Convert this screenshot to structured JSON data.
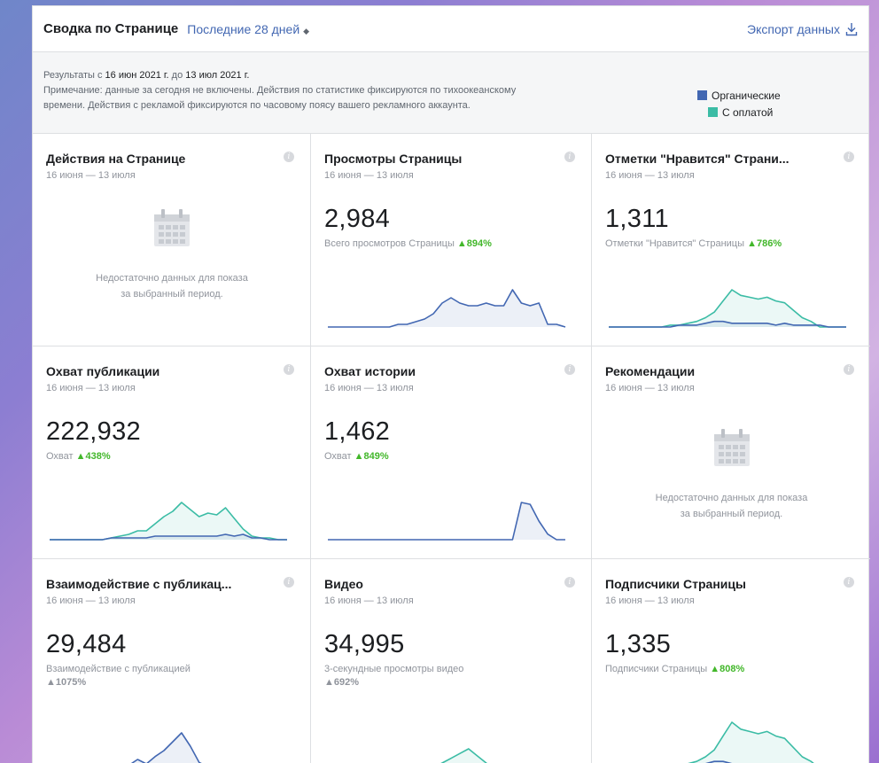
{
  "header": {
    "title": "Сводка по Странице",
    "range": "Последние 28 дней",
    "export": "Экспорт данных"
  },
  "note": {
    "results_prefix": "Результаты с ",
    "date_from": "16 июн 2021 г.",
    "results_mid": " до ",
    "date_to": "13 июл 2021 г.",
    "line2": "Примечание: данные за сегодня не включены. Действия по статистике фиксируются по тихоокеанскому",
    "line3": "времени. Действия с рекламой фиксируются по часовому поясу вашего рекламного аккаунта."
  },
  "legend": {
    "organic": "Органические",
    "paid": "С оплатой"
  },
  "colors": {
    "organic": "#4267b2",
    "paid": "#3bbca5",
    "accent": "#4267b2",
    "up": "#42b72a"
  },
  "cards": [
    {
      "title": "Действия на Странице",
      "date": "16 июня — 13 июля",
      "no_data_line1": "Недостаточно данных для показа",
      "no_data_line2": "за выбранный период."
    },
    {
      "title": "Просмотры Страницы",
      "date": "16 июня — 13 июля",
      "value": "2,984",
      "sub": "Всего просмотров Страницы",
      "change": "▲894%"
    },
    {
      "title": "Отметки \"Нравится\" Страни...",
      "date": "16 июня — 13 июля",
      "value": "1,311",
      "sub": "Отметки \"Нравится\" Страницы",
      "change": "▲786%"
    },
    {
      "title": "Охват публикации",
      "date": "16 июня — 13 июля",
      "value": "222,932",
      "sub": "Охват",
      "change": "▲438%"
    },
    {
      "title": "Охват истории",
      "date": "16 июня — 13 июля",
      "value": "1,462",
      "sub": "Охват",
      "change": "▲849%"
    },
    {
      "title": "Рекомендации",
      "date": "16 июня — 13 июля",
      "no_data_line1": "Недостаточно данных для показа",
      "no_data_line2": "за выбранный период."
    },
    {
      "title": "Взаимодействие с публикац...",
      "date": "16 июня — 13 июля",
      "value": "29,484",
      "sub": "Взаимодействие с публикацией",
      "change": "▲1075%"
    },
    {
      "title": "Видео",
      "date": "16 июня — 13 июля",
      "value": "34,995",
      "sub": "3-секундные просмотры видео",
      "change": "▲692%"
    },
    {
      "title": "Подписчики Страницы",
      "date": "16 июня — 13 июля",
      "value": "1,335",
      "sub": "Подписчики Страницы",
      "change": "▲808%"
    }
  ],
  "chart_data": [
    {
      "type": "line",
      "card": "Просмотры Страницы",
      "series": [
        {
          "values": [
            0,
            0,
            0,
            0,
            0,
            0,
            0,
            0,
            1,
            1,
            2,
            3,
            5,
            9,
            11,
            9,
            8,
            8,
            9,
            8,
            8,
            14,
            9,
            8,
            9,
            1,
            1,
            0
          ]
        }
      ]
    },
    {
      "type": "area",
      "card": "Отметки \"Нравится\" Страницы",
      "series": [
        {
          "values": [
            0,
            0,
            0,
            0,
            0,
            0,
            0,
            0,
            1,
            1,
            1,
            2,
            3,
            3,
            2,
            2,
            2,
            2,
            2,
            1,
            2,
            1,
            1,
            1,
            1,
            0,
            0,
            0
          ]
        },
        {
          "values": [
            0,
            0,
            0,
            0,
            0,
            0,
            0,
            1,
            1,
            2,
            3,
            5,
            8,
            14,
            20,
            17,
            16,
            15,
            16,
            14,
            13,
            9,
            5,
            3,
            0,
            0,
            0,
            0
          ]
        }
      ]
    },
    {
      "type": "area",
      "card": "Охват публикации",
      "series": [
        {
          "values": [
            0,
            0,
            0,
            0,
            0,
            0,
            0,
            1,
            1,
            1,
            1,
            1,
            2,
            2,
            2,
            2,
            2,
            2,
            2,
            2,
            3,
            2,
            3,
            1,
            1,
            0,
            0,
            0
          ]
        },
        {
          "values": [
            0,
            0,
            0,
            0,
            0,
            0,
            0,
            1,
            2,
            3,
            5,
            5,
            9,
            13,
            16,
            21,
            17,
            13,
            15,
            14,
            18,
            12,
            6,
            2,
            1,
            1,
            0,
            0
          ]
        }
      ]
    },
    {
      "type": "line",
      "card": "Охват истории",
      "series": [
        {
          "values": [
            0,
            0,
            0,
            0,
            0,
            0,
            0,
            0,
            0,
            0,
            0,
            0,
            0,
            0,
            0,
            0,
            0,
            0,
            0,
            0,
            0,
            0,
            20,
            19,
            10,
            3,
            0,
            0
          ]
        }
      ]
    },
    {
      "type": "line",
      "card": "Взаимодействие с публикацией",
      "series": [
        {
          "values": [
            0,
            0,
            0,
            0,
            0,
            0,
            1,
            2,
            4,
            8,
            12,
            9,
            14,
            18,
            24,
            30,
            21,
            10,
            7,
            5,
            4,
            3,
            2,
            1,
            0,
            0,
            0,
            0
          ]
        }
      ]
    },
    {
      "type": "area",
      "card": "Видео",
      "series": [
        {
          "values": [
            0,
            0,
            0,
            0,
            0,
            0,
            0,
            0,
            0,
            1,
            1,
            1,
            1,
            2,
            2,
            3,
            3,
            3,
            2,
            1,
            1,
            1,
            1,
            0,
            0,
            0,
            0,
            0
          ]
        },
        {
          "values": [
            0,
            0,
            0,
            0,
            0,
            0,
            0,
            0,
            1,
            1,
            2,
            3,
            4,
            6,
            8,
            10,
            12,
            9,
            6,
            3,
            2,
            2,
            1,
            1,
            0,
            0,
            0,
            0
          ]
        }
      ]
    },
    {
      "type": "area",
      "card": "Подписчики Страницы",
      "series": [
        {
          "values": [
            0,
            0,
            0,
            0,
            0,
            0,
            0,
            0,
            1,
            1,
            1,
            2,
            3,
            3,
            2,
            2,
            2,
            2,
            2,
            1,
            2,
            1,
            1,
            1,
            1,
            0,
            0,
            0
          ]
        },
        {
          "values": [
            0,
            0,
            0,
            0,
            0,
            0,
            0,
            1,
            1,
            2,
            3,
            5,
            8,
            14,
            20,
            17,
            16,
            15,
            16,
            14,
            13,
            9,
            5,
            3,
            0,
            0,
            0,
            0
          ]
        }
      ]
    }
  ]
}
